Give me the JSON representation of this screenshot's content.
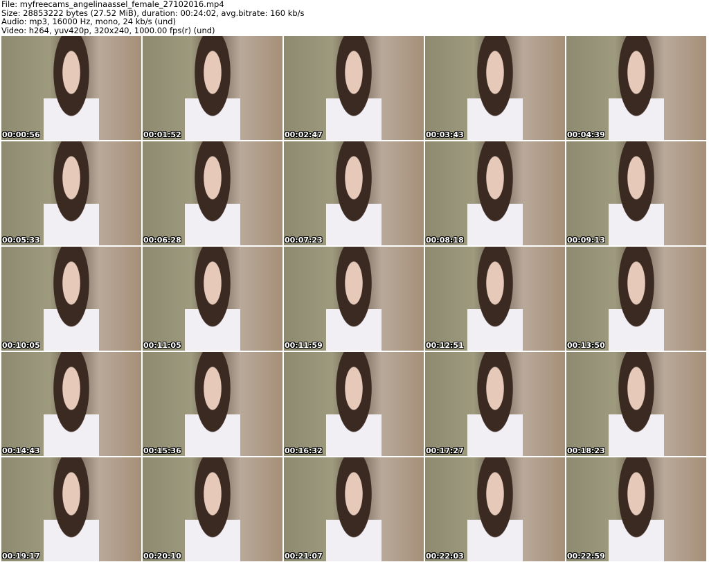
{
  "header": {
    "file": "File: myfreecams_angelinaassel_female_27102016.mp4",
    "size": "Size: 28853222 bytes (27.52 MiB), duration: 00:24:02, avg.bitrate: 160 kb/s",
    "audio": "Audio: mp3, 16000 Hz, mono, 24 kb/s (und)",
    "video": "Video: h264, yuv420p, 320x240, 1000.00 fps(r) (und)"
  },
  "thumbnails": [
    "00:00:56",
    "00:01:52",
    "00:02:47",
    "00:03:43",
    "00:04:39",
    "00:05:33",
    "00:06:28",
    "00:07:23",
    "00:08:18",
    "00:09:13",
    "00:10:05",
    "00:11:05",
    "00:11:59",
    "00:12:51",
    "00:13:50",
    "00:14:43",
    "00:15:36",
    "00:16:32",
    "00:17:27",
    "00:18:23",
    "00:19:17",
    "00:20:10",
    "00:21:07",
    "00:22:03",
    "00:22:59"
  ]
}
